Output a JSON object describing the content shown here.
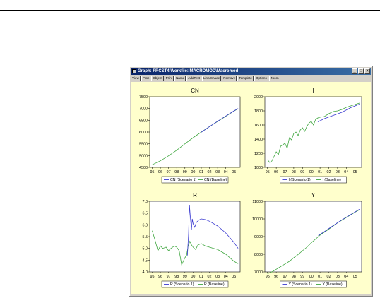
{
  "window": {
    "title": "Graph: FRCST4   Workfile: MACROMOD\\Macromod",
    "controls": {
      "minimize": "_",
      "maximize": "□",
      "close": "×"
    }
  },
  "toolbar": [
    "View",
    "Proc",
    "Object",
    "Print",
    "Name",
    "AddText",
    "Line/Shade",
    "Remove",
    "Template",
    "Options",
    "Zoom"
  ],
  "colors": {
    "scenario": "#3a3ad0",
    "baseline": "#3fa63f"
  },
  "chart_data": [
    {
      "type": "line",
      "title": "CN",
      "xticks": [
        "95",
        "96",
        "97",
        "98",
        "99",
        "00",
        "01",
        "02",
        "03",
        "04",
        "05"
      ],
      "yticks": [
        "4500",
        "5000",
        "5500",
        "6000",
        "6500",
        "7000",
        "7500"
      ],
      "ylim": [
        4500,
        7500
      ],
      "series": [
        {
          "name": "CN (Scenario 1)",
          "x": [
            2001.0,
            2002.0,
            2003.0,
            2004.0,
            2005.0,
            2005.5
          ],
          "y": [
            5990,
            6230,
            6460,
            6680,
            6900,
            7000
          ]
        },
        {
          "name": "CN (Baseline)",
          "x": [
            1995.0,
            1996.0,
            1997.0,
            1998.0,
            1999.0,
            2000.0,
            2001.0,
            2002.0,
            2003.0,
            2004.0,
            2005.0,
            2005.5
          ],
          "y": [
            4610,
            4780,
            4990,
            5230,
            5500,
            5760,
            6000,
            6230,
            6450,
            6670,
            6890,
            6990
          ]
        }
      ],
      "legend": [
        "CN (Scenario 1)",
        "CN (Baseline)"
      ]
    },
    {
      "type": "line",
      "title": "I",
      "xticks": [
        "95",
        "96",
        "97",
        "98",
        "99",
        "00",
        "01",
        "02",
        "03",
        "04",
        "05"
      ],
      "yticks": [
        "1000",
        "1200",
        "1400",
        "1600",
        "1800",
        "2000"
      ],
      "ylim": [
        1000,
        2000
      ],
      "series": [
        {
          "name": "I (Scenario 1)",
          "x": [
            2000.75,
            2001.5,
            2002.5,
            2003.5,
            2004.5,
            2005.5
          ],
          "y": [
            1645,
            1690,
            1735,
            1780,
            1845,
            1895
          ]
        },
        {
          "name": "I (Baseline)",
          "x": [
            1995.0,
            1995.25,
            1995.5,
            1996.0,
            1996.25,
            1996.5,
            1997.0,
            1997.25,
            1997.5,
            1997.75,
            1998.0,
            1998.25,
            1998.5,
            1998.75,
            1999.0,
            1999.25,
            1999.5,
            1999.75,
            2000.0,
            2000.25,
            2000.5,
            2000.75,
            2001.0,
            2001.5,
            2002.0,
            2002.5,
            2003.0,
            2003.5,
            2004.0,
            2004.5,
            2005.0,
            2005.5
          ],
          "y": [
            1110,
            1070,
            1090,
            1220,
            1180,
            1300,
            1340,
            1270,
            1420,
            1390,
            1480,
            1500,
            1450,
            1530,
            1560,
            1510,
            1580,
            1630,
            1650,
            1600,
            1680,
            1700,
            1710,
            1720,
            1760,
            1790,
            1800,
            1820,
            1850,
            1870,
            1890,
            1910
          ]
        }
      ],
      "legend": [
        "I (Scenario 1)",
        "I (Baseline)"
      ]
    },
    {
      "type": "line",
      "title": "R",
      "xticks": [
        "95",
        "96",
        "97",
        "98",
        "99",
        "00",
        "01",
        "02",
        "03",
        "04",
        "05"
      ],
      "yticks": [
        "4.0",
        "4.5",
        "5.0",
        "5.5",
        "6.0",
        "6.5",
        "7.0"
      ],
      "ylim": [
        4.0,
        7.0
      ],
      "series": [
        {
          "name": "R (Scenario 1)",
          "x": [
            1999.3,
            1999.45,
            1999.55,
            1999.65,
            1999.8,
            1999.9,
            2000.0,
            2000.2,
            2000.4,
            2000.7,
            2001.0,
            2001.5,
            2002.0,
            2003.0,
            2004.0,
            2005.0,
            2005.5
          ],
          "y": [
            4.7,
            5.6,
            6.85,
            6.4,
            5.8,
            6.25,
            6.05,
            5.9,
            6.1,
            6.2,
            6.25,
            6.22,
            6.15,
            5.95,
            5.65,
            5.25,
            5.0
          ]
        },
        {
          "name": "R (Baseline)",
          "x": [
            1995.0,
            1995.3,
            1995.7,
            1996.0,
            1996.3,
            1996.7,
            1997.0,
            1997.3,
            1997.7,
            1998.0,
            1998.3,
            1998.6,
            1998.8,
            1999.0,
            1999.2,
            1999.4,
            1999.6,
            1999.8,
            2000.0,
            2000.3,
            2000.6,
            2001.0,
            2001.5,
            2002.0,
            2002.5,
            2003.0,
            2004.0,
            2005.0,
            2005.5
          ],
          "y": [
            5.75,
            5.4,
            4.9,
            5.1,
            5.0,
            5.05,
            4.9,
            5.0,
            5.1,
            5.05,
            4.9,
            4.3,
            4.45,
            4.6,
            4.7,
            5.1,
            5.3,
            5.15,
            5.05,
            4.95,
            5.15,
            5.2,
            5.1,
            5.05,
            5.0,
            4.95,
            4.75,
            4.45,
            4.35
          ]
        }
      ],
      "legend": [
        "R (Scenario 1)",
        "R (Baseline)"
      ]
    },
    {
      "type": "line",
      "title": "Y",
      "xticks": [
        "95",
        "96",
        "97",
        "98",
        "99",
        "00",
        "01",
        "02",
        "03",
        "04",
        "05"
      ],
      "yticks": [
        "7000",
        "8000",
        "9000",
        "10000",
        "11000"
      ],
      "ylim": [
        7000,
        11000
      ],
      "series": [
        {
          "name": "Y (Scenario 1)",
          "x": [
            2000.8,
            2001.5,
            2002.5,
            2003.5,
            2004.5,
            2005.5
          ],
          "y": [
            9060,
            9280,
            9620,
            9950,
            10250,
            10550
          ]
        },
        {
          "name": "Y (Baseline)",
          "x": [
            1995.0,
            1995.5,
            1996.0,
            1996.5,
            1997.0,
            1997.5,
            1998.0,
            1998.5,
            1999.0,
            1999.5,
            2000.0,
            2000.5,
            2001.0,
            2002.0,
            2003.0,
            2004.0,
            2005.0,
            2005.5
          ],
          "y": [
            6900,
            7000,
            7150,
            7300,
            7450,
            7600,
            7800,
            7990,
            8200,
            8400,
            8650,
            8860,
            9080,
            9420,
            9780,
            10080,
            10380,
            10520
          ]
        }
      ],
      "legend": [
        "Y (Scenario 1)",
        "Y (Baseline)"
      ]
    }
  ]
}
